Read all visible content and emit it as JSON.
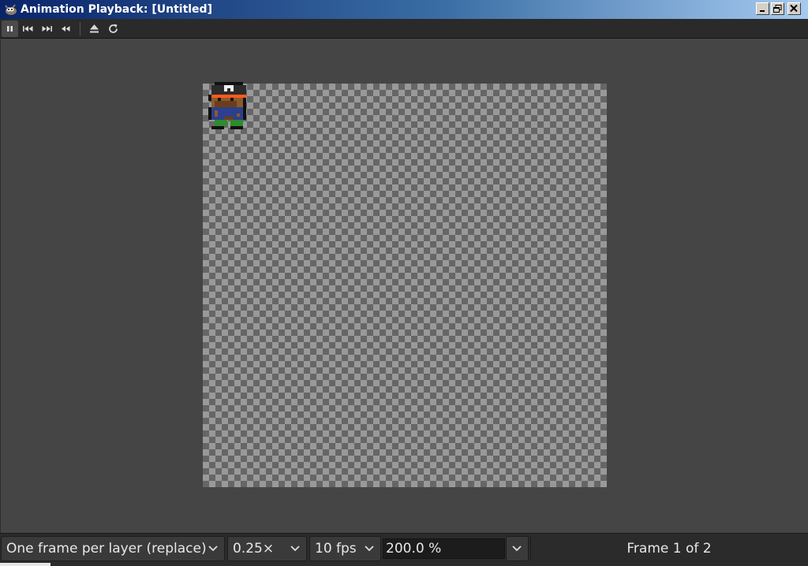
{
  "window": {
    "title": "Animation Playback: [Untitled]",
    "icon": "gimp-wilber-icon"
  },
  "toolbar": {
    "buttons": [
      {
        "name": "pause",
        "icon": "pause-icon",
        "active": true
      },
      {
        "name": "first-frame",
        "icon": "skip-to-start-icon"
      },
      {
        "name": "next-frame",
        "icon": "skip-to-end-icon"
      },
      {
        "name": "rewind",
        "icon": "rewind-icon"
      },
      {
        "name": "detach",
        "icon": "eject-icon"
      },
      {
        "name": "reload",
        "icon": "refresh-icon"
      }
    ]
  },
  "statusbar": {
    "frame_mode": "One frame per layer (replace)",
    "speed": "0.25×",
    "framerate": "10 fps",
    "zoom": "200.0 %",
    "frame_indicator": "Frame 1 of 2"
  },
  "colors": {
    "background": "#454545",
    "toolbar": "#2a2a2a",
    "checker_dark": "#666666",
    "checker_light": "#999999"
  }
}
